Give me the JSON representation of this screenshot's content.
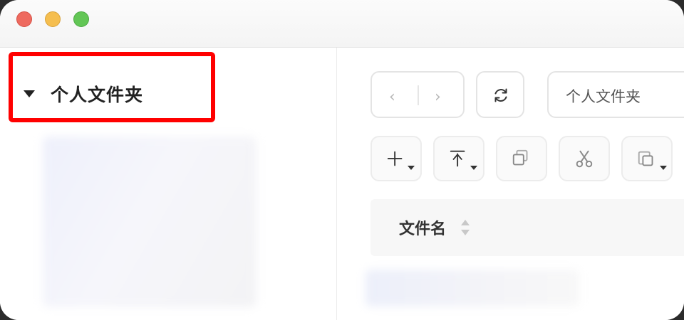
{
  "window": {
    "traffic_lights": {
      "close": "#ee6a5f",
      "minimize": "#f5be4f",
      "maximize": "#62c655"
    }
  },
  "sidebar": {
    "folder_label": "个人文件夹",
    "highlight_color": "#ff0000"
  },
  "toolbar": {
    "back_icon": "chevron-left-icon",
    "forward_icon": "chevron-right-icon",
    "back_glyph": "‹",
    "forward_glyph": "›",
    "refresh_icon": "refresh-icon",
    "path_value": "个人文件夹"
  },
  "actions": [
    {
      "icon": "add-icon",
      "has_dropdown": true
    },
    {
      "icon": "upload-icon",
      "has_dropdown": true
    },
    {
      "icon": "copy-icon",
      "has_dropdown": false
    },
    {
      "icon": "cut-icon",
      "has_dropdown": false
    },
    {
      "icon": "paste-icon",
      "has_dropdown": true
    }
  ],
  "table": {
    "columns": [
      {
        "label": "文件名",
        "sortable": true
      }
    ]
  }
}
